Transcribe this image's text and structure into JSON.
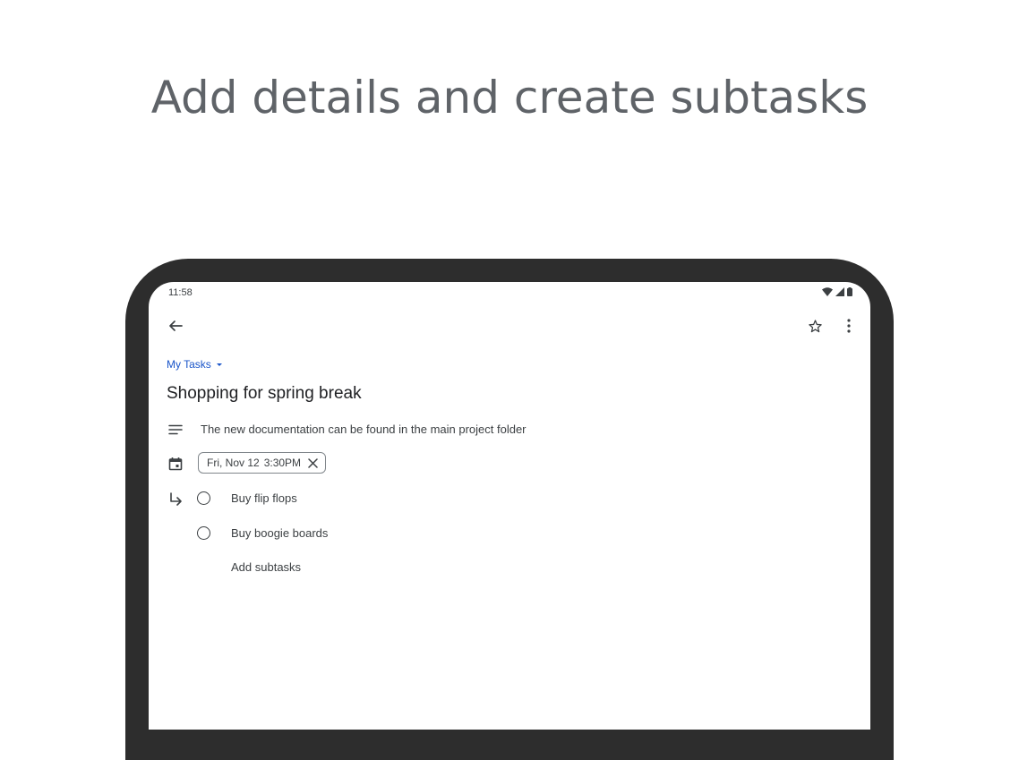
{
  "headline": "Add details and create subtasks",
  "status_bar": {
    "time": "11:58"
  },
  "list_select": {
    "label": "My Tasks"
  },
  "task": {
    "title": "Shopping for spring break",
    "details": "The new documentation can be found in the main project folder",
    "date_chip": {
      "date": "Fri, Nov 12",
      "time": "3:30PM"
    },
    "subtasks": [
      {
        "label": "Buy flip flops"
      },
      {
        "label": "Buy boogie boards"
      }
    ],
    "add_subtasks_label": "Add subtasks"
  },
  "colors": {
    "headline": "#5f6368",
    "accent": "#1a55c9",
    "device_frame": "#2d2d2d",
    "text": "#202124"
  },
  "icons": [
    "arrow-back-icon",
    "star-outline-icon",
    "more-vert-icon",
    "notes-icon",
    "calendar-icon",
    "subdirectory-arrow-icon",
    "close-icon",
    "dropdown-icon",
    "wifi-icon",
    "signal-icon",
    "battery-icon"
  ]
}
